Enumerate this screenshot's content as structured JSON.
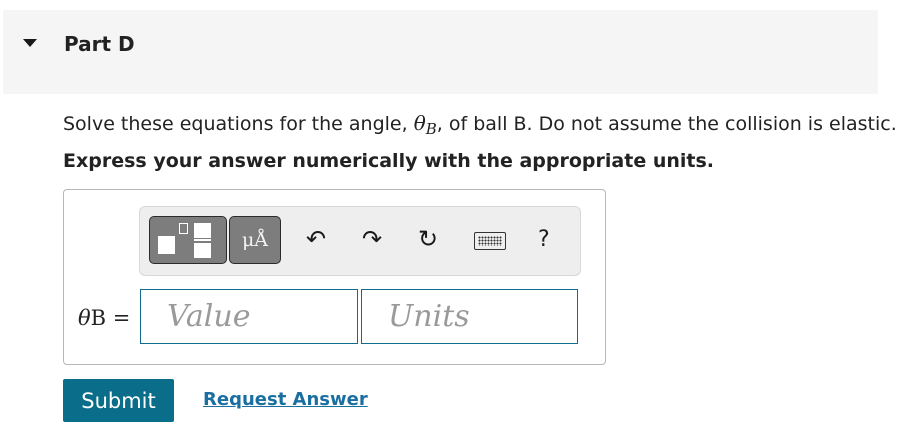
{
  "part": {
    "title": "Part D"
  },
  "question": {
    "prefix": "Solve these equations for the angle, ",
    "symbol": "θ",
    "subscript": "B",
    "suffix": ", of ball B. Do not assume the collision is elastic."
  },
  "instruction": "Express your answer numerically with the appropriate units.",
  "toolbar": {
    "symbols_label": "μÅ",
    "undo_icon": "undo-icon",
    "redo_icon": "redo-icon",
    "reset_icon": "reset-icon",
    "keyboard_icon": "keyboard-icon",
    "help_label": "?"
  },
  "answer": {
    "label_symbol": "θ",
    "label_sub": "B",
    "label_eq": " =",
    "value_placeholder": "Value",
    "units_placeholder": "Units"
  },
  "actions": {
    "submit_label": "Submit",
    "request_label": "Request Answer"
  },
  "colors": {
    "accent": "#0a6e8a",
    "link": "#1a6fa0",
    "input_border": "#0f6c8a"
  }
}
